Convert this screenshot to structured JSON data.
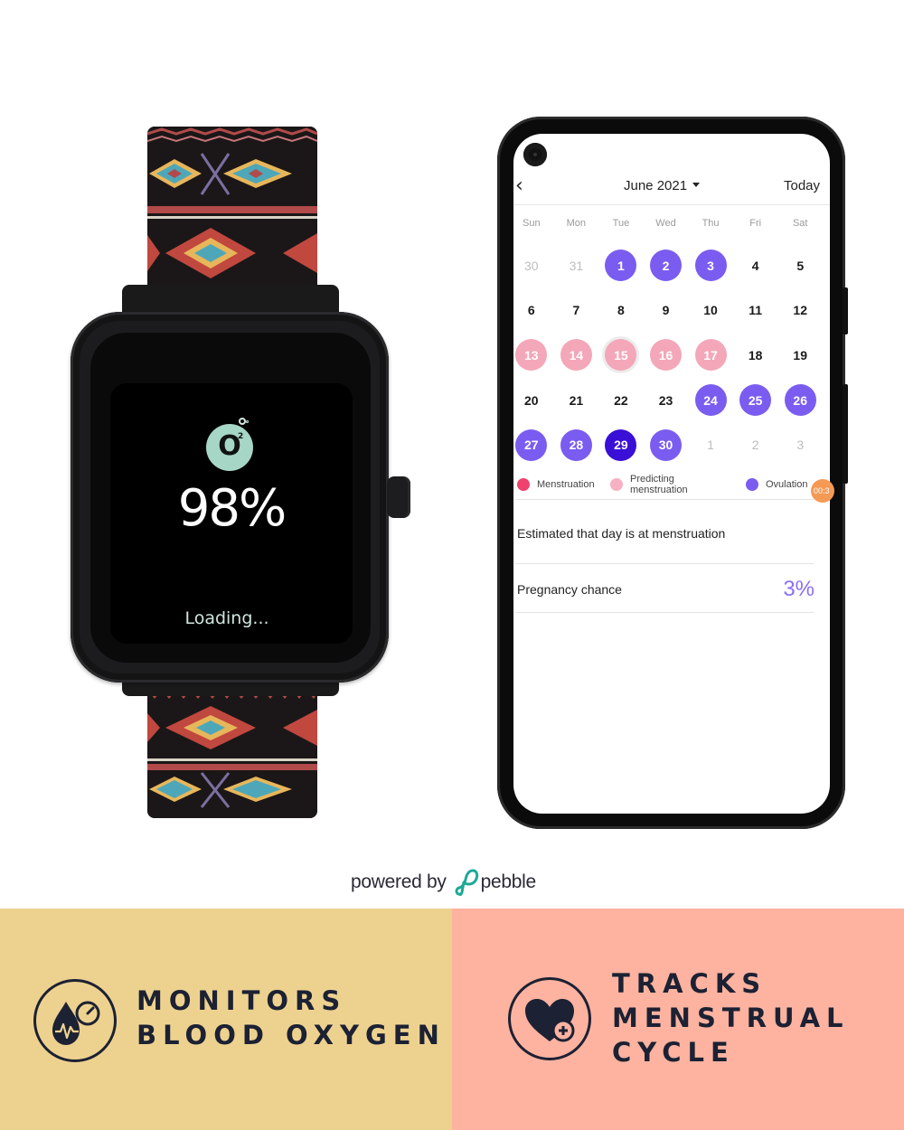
{
  "watch": {
    "icon": "o2-bubble-icon",
    "o2_main": "O",
    "o2_sup": "2",
    "spo2_value": "98%",
    "status": "Loading..."
  },
  "phone": {
    "calendar": {
      "back_icon": "chevron-left-icon",
      "back_glyph": "‹",
      "month_label": "June 2021",
      "today_label": "Today",
      "weekdays": [
        "Sun",
        "Mon",
        "Tue",
        "Wed",
        "Thu",
        "Fri",
        "Sat"
      ],
      "days": [
        {
          "n": "30",
          "state": "muted"
        },
        {
          "n": "31",
          "state": "muted"
        },
        {
          "n": "1",
          "state": "ovulation"
        },
        {
          "n": "2",
          "state": "ovulation"
        },
        {
          "n": "3",
          "state": "ovulation"
        },
        {
          "n": "4",
          "state": ""
        },
        {
          "n": "5",
          "state": ""
        },
        {
          "n": "6",
          "state": ""
        },
        {
          "n": "7",
          "state": ""
        },
        {
          "n": "8",
          "state": ""
        },
        {
          "n": "9",
          "state": ""
        },
        {
          "n": "10",
          "state": ""
        },
        {
          "n": "11",
          "state": ""
        },
        {
          "n": "12",
          "state": ""
        },
        {
          "n": "13",
          "state": "predict"
        },
        {
          "n": "14",
          "state": "predict"
        },
        {
          "n": "15",
          "state": "predict today"
        },
        {
          "n": "16",
          "state": "predict"
        },
        {
          "n": "17",
          "state": "predict"
        },
        {
          "n": "18",
          "state": ""
        },
        {
          "n": "19",
          "state": ""
        },
        {
          "n": "20",
          "state": ""
        },
        {
          "n": "21",
          "state": ""
        },
        {
          "n": "22",
          "state": ""
        },
        {
          "n": "23",
          "state": ""
        },
        {
          "n": "24",
          "state": "ovulation"
        },
        {
          "n": "25",
          "state": "ovulation"
        },
        {
          "n": "26",
          "state": "ovulation"
        },
        {
          "n": "27",
          "state": "ovulation"
        },
        {
          "n": "28",
          "state": "ovulation"
        },
        {
          "n": "29",
          "state": "selected"
        },
        {
          "n": "30",
          "state": "ovulation"
        },
        {
          "n": "1",
          "state": "muted"
        },
        {
          "n": "2",
          "state": "muted"
        },
        {
          "n": "3",
          "state": "muted"
        }
      ],
      "legend": [
        {
          "label": "Menstruation",
          "color": "#f0426e"
        },
        {
          "label": "Predicting menstruation",
          "color": "#f7b1c3"
        },
        {
          "label": "Ovulation",
          "color": "#7b5cf0"
        }
      ],
      "timer_badge": "00:3"
    },
    "estimate_text": "Estimated that day is at menstruation",
    "pregnancy_label": "Pregnancy chance",
    "pregnancy_value": "3%"
  },
  "branding": {
    "powered_by": "powered by",
    "brand": "pebble",
    "brand_color": "#1ea897"
  },
  "features": [
    {
      "icon": "blood-oxygen-drop-gauge-icon",
      "lines": [
        "MONITORS",
        "BLOOD OXYGEN"
      ],
      "bg": "#edd28f"
    },
    {
      "icon": "heart-plus-icon",
      "lines": [
        "TRACKS",
        "MENSTRUAL",
        "CYCLE"
      ],
      "bg": "#fdb3a0"
    }
  ],
  "colors": {
    "ovulation": "#7b5cf0",
    "predict": "#f4a7b9",
    "selected": "#3a0fd6",
    "text_dark": "#1c2133"
  }
}
